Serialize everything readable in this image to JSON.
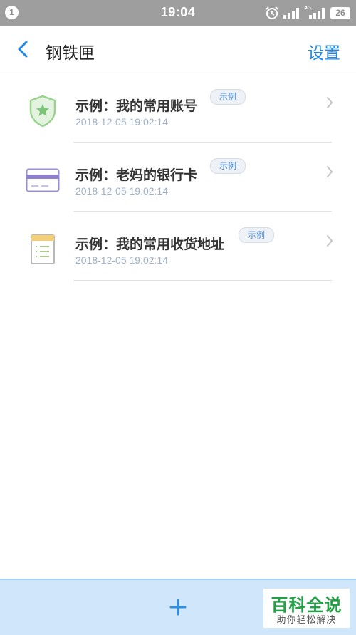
{
  "status_bar": {
    "notification_count": "1",
    "time": "19:04",
    "network_label": "4G",
    "battery": "26"
  },
  "nav": {
    "title": "钢铁匣",
    "settings_label": "设置"
  },
  "items": [
    {
      "icon": "shield-star-icon",
      "title": "示例：我的常用账号",
      "badge": "示例",
      "date": "2018-12-05 19:02:14"
    },
    {
      "icon": "bank-card-icon",
      "title": "示例：老妈的银行卡",
      "badge": "示例",
      "date": "2018-12-05 19:02:14"
    },
    {
      "icon": "address-note-icon",
      "title": "示例：我的常用收货地址",
      "badge": "示例",
      "date": "2018-12-05 19:02:14"
    }
  ],
  "bottom_bar": {
    "add_icon": "plus-icon"
  },
  "watermark": {
    "title": "百科全说",
    "subtitle": "助你轻松解决"
  },
  "colors": {
    "accent": "#1e88e5",
    "status_bar": "#9e9e9e",
    "bottom_bar": "#cfe6fb",
    "badge_text": "#4a8fd8",
    "date_text": "#9fb0c6",
    "watermark": "#21a045"
  }
}
